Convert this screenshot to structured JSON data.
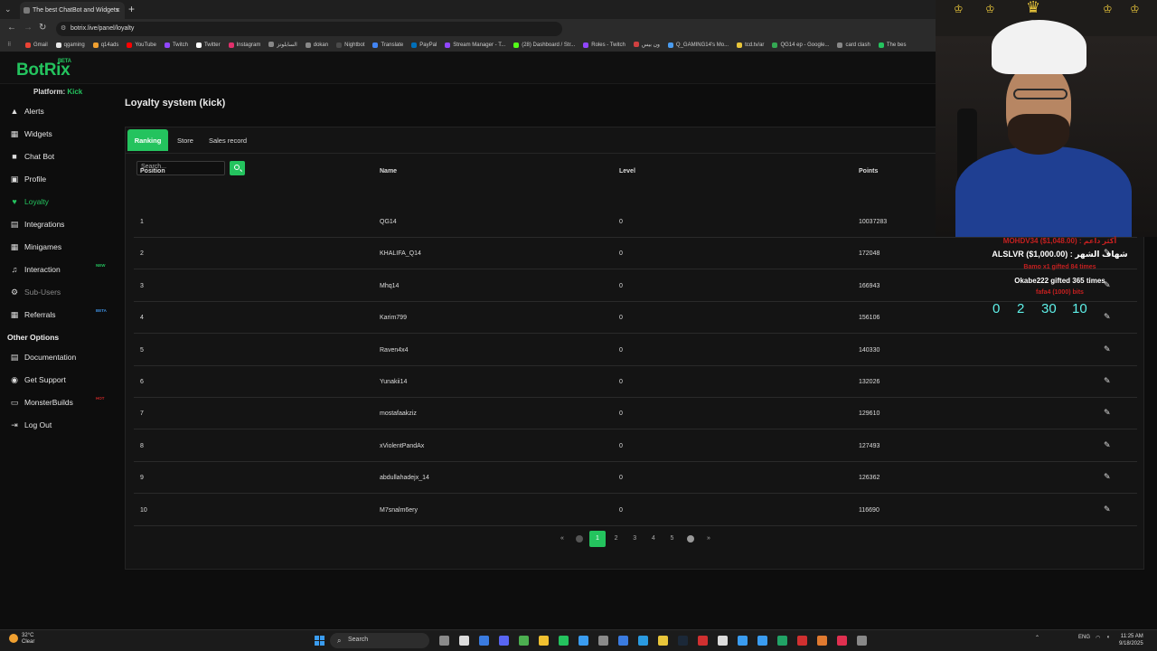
{
  "browser": {
    "tab_title": "The best ChatBot and Widgets",
    "url": "botrix.live/panel/loyalty",
    "bookmarks": [
      {
        "label": "Gmail",
        "color": "#ea4335"
      },
      {
        "label": "qgaming",
        "color": "#e8e8e8"
      },
      {
        "label": "q14ads",
        "color": "#f0a030"
      },
      {
        "label": "YouTube",
        "color": "#ff0000"
      },
      {
        "label": "Twitch",
        "color": "#9146ff"
      },
      {
        "label": "Twitter",
        "color": "#ffffff"
      },
      {
        "label": "Instagram",
        "color": "#e1306c"
      },
      {
        "label": "السابلونز",
        "color": "#888888"
      },
      {
        "label": "dokan",
        "color": "#888888"
      },
      {
        "label": "Nightbot",
        "color": "#4a4a4a"
      },
      {
        "label": "Translate",
        "color": "#4285f4"
      },
      {
        "label": "PayPal",
        "color": "#0070ba"
      },
      {
        "label": "Stream Manager - T...",
        "color": "#9146ff"
      },
      {
        "label": "(28) Dashboard / Str...",
        "color": "#53fc18"
      },
      {
        "label": "Roles - Twitch",
        "color": "#9146ff"
      },
      {
        "label": "ون بيس",
        "color": "#d04040"
      },
      {
        "label": "Q_GAMING14's Mo...",
        "color": "#4a9cf0"
      },
      {
        "label": "tcd.tv/ar",
        "color": "#e8c53a"
      },
      {
        "label": "QG14 ep - Google...",
        "color": "#34a853"
      },
      {
        "label": "card clash",
        "color": "#888888"
      },
      {
        "label": "The bes",
        "color": "#24c35e"
      }
    ]
  },
  "app": {
    "logo": "BotRix",
    "logo_badge": "BETA",
    "platform_label": "Platform:",
    "platform_value": "Kick",
    "page_title": "Loyalty system (kick)",
    "accent": "#24c35e"
  },
  "sidebar": {
    "items": [
      {
        "label": "Alerts",
        "icon": "warning-icon",
        "glyph": "▲"
      },
      {
        "label": "Widgets",
        "icon": "widgets-icon",
        "glyph": "▦"
      },
      {
        "label": "Chat Bot",
        "icon": "chat-icon",
        "glyph": "■"
      },
      {
        "label": "Profile",
        "icon": "profile-icon",
        "glyph": "▣"
      },
      {
        "label": "Loyalty",
        "icon": "heart-icon",
        "glyph": "♥"
      },
      {
        "label": "Integrations",
        "icon": "integrations-icon",
        "glyph": "▤"
      },
      {
        "label": "Minigames",
        "icon": "gamepad-icon",
        "glyph": "▦"
      },
      {
        "label": "Interaction",
        "icon": "music-icon",
        "glyph": "♫",
        "tag": "NEW"
      },
      {
        "label": "Sub-Users",
        "icon": "users-icon",
        "glyph": "⚙"
      },
      {
        "label": "Referrals",
        "icon": "referrals-icon",
        "glyph": "▦",
        "tag": "BETA"
      }
    ],
    "section_title": "Other Options",
    "other_items": [
      {
        "label": "Documentation",
        "icon": "book-icon",
        "glyph": "▤"
      },
      {
        "label": "Get Support",
        "icon": "support-icon",
        "glyph": "◉"
      },
      {
        "label": "MonsterBuilds",
        "icon": "monitor-icon",
        "glyph": "▭",
        "tag": "HOT"
      },
      {
        "label": "Log Out",
        "icon": "logout-icon",
        "glyph": "⇥"
      }
    ]
  },
  "tabs": {
    "ranking": "Ranking",
    "store": "Store",
    "sales": "Sales record"
  },
  "search": {
    "placeholder": "Search..."
  },
  "table": {
    "headers": {
      "position": "Position",
      "name": "Name",
      "level": "Level",
      "points": "Points"
    },
    "rows": [
      {
        "position": "1",
        "name": "QG14",
        "level": "0",
        "points": "10037283"
      },
      {
        "position": "2",
        "name": "KHALIFA_Q14",
        "level": "0",
        "points": "172048"
      },
      {
        "position": "3",
        "name": "Mhq14",
        "level": "0",
        "points": "166943"
      },
      {
        "position": "4",
        "name": "Karim799",
        "level": "0",
        "points": "156106"
      },
      {
        "position": "5",
        "name": "Raven4x4",
        "level": "0",
        "points": "140330"
      },
      {
        "position": "6",
        "name": "Yunakii14",
        "level": "0",
        "points": "132026"
      },
      {
        "position": "7",
        "name": "mostafaakziz",
        "level": "0",
        "points": "129610"
      },
      {
        "position": "8",
        "name": "xViolentPandAx",
        "level": "0",
        "points": "127493"
      },
      {
        "position": "9",
        "name": "abdullahadejx_14",
        "level": "0",
        "points": "126362"
      },
      {
        "position": "10",
        "name": "M7snalm6ery",
        "level": "0",
        "points": "116690"
      }
    ]
  },
  "pagination": {
    "first": "«",
    "pages": [
      "1",
      "2",
      "3",
      "4",
      "5"
    ],
    "last": "»",
    "current": "1"
  },
  "overlay": {
    "line1": "MOHDV34 ($1,048.00) : أكثر داعم",
    "line2": "ALSLVR ($1,000.00) : شهاف الشهر",
    "line3": "Bamo x1 gifted 84 times",
    "line4": "Okabe222 gifted 365 times",
    "line5": "fafa4 (1000) bits",
    "timer": [
      "0",
      "2",
      "30",
      "10"
    ]
  },
  "taskbar": {
    "weather_temp": "32°C",
    "weather_desc": "Clear",
    "search": "Search",
    "lang": "ENG",
    "time": "11:25 AM",
    "date": "9/18/2025"
  }
}
